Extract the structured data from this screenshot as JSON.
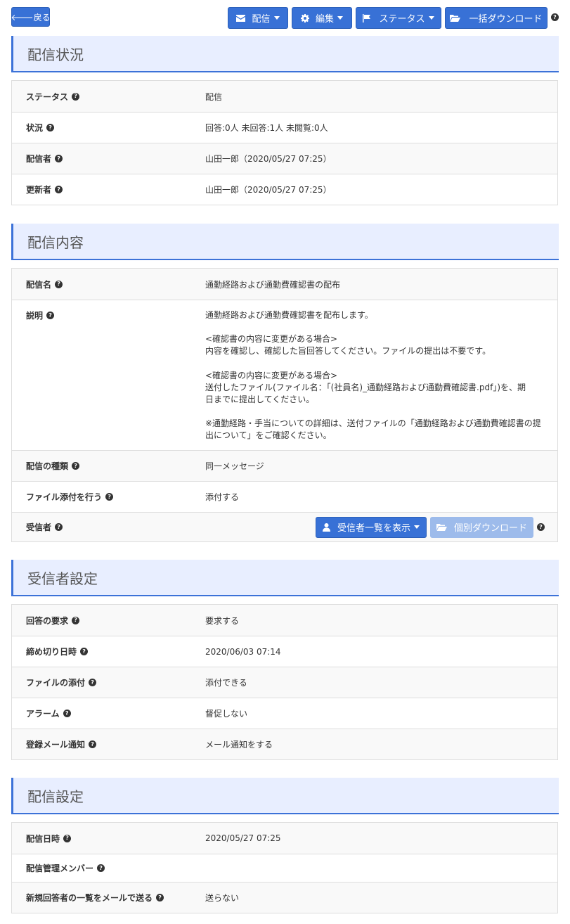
{
  "toolbar": {
    "back_label": "戻る",
    "deliver_label": "配信",
    "edit_label": "編集",
    "status_label": "ステータス",
    "bulk_download_label": "一括ダウンロード"
  },
  "help_glyph": "?",
  "section_status": {
    "title": "配信状況",
    "rows": [
      {
        "label": "ステータス",
        "value": "配信"
      },
      {
        "label": "状況",
        "value": "回答:0人 未回答:1人 未閲覧:0人"
      },
      {
        "label": "配信者",
        "value": "山田一郎（2020/05/27 07:25）"
      },
      {
        "label": "更新者",
        "value": "山田一郎（2020/05/27 07:25）"
      }
    ]
  },
  "section_content": {
    "title": "配信内容",
    "name_label": "配信名",
    "name_value": "通勤経路および通勤費確認書の配布",
    "description_label": "説明",
    "description": [
      "通勤経路および通勤費確認書を配布します。",
      "<確認書の内容に変更がある場合>",
      "内容を確認し、確認した旨回答してください。ファイルの提出は不要です。",
      "<確認書の内容に変更がある場合>",
      "送付したファイル(ファイル名：「(社員名)_通勤経路および通勤費確認書.pdf」)を、期",
      "日までに提出してください。",
      "※通勤経路・手当についての詳細は、送付ファイルの「通勤経路および通勤費確認書の提",
      "出について」をご確認ください。"
    ],
    "type_label": "配信の種類",
    "type_value": "同一メッセージ",
    "attach_label": "ファイル添付を行う",
    "attach_value": "添付する",
    "recipients_label": "受信者",
    "show_recipients_label": "受信者一覧を表示",
    "individual_download_label": "個別ダウンロード"
  },
  "section_recipient": {
    "title": "受信者設定",
    "rows": [
      {
        "label": "回答の要求",
        "value": "要求する"
      },
      {
        "label": "締め切り日時",
        "value": "2020/06/03 07:14"
      },
      {
        "label": "ファイルの添付",
        "value": "添付できる"
      },
      {
        "label": "アラーム",
        "value": "督促しない"
      },
      {
        "label": "登録メール通知",
        "value": "メール通知をする"
      }
    ]
  },
  "section_settings": {
    "title": "配信設定",
    "rows": [
      {
        "label": "配信日時",
        "value": "2020/05/27 07:25"
      },
      {
        "label": "配信管理メンバー",
        "value": ""
      },
      {
        "label": "新規回答者の一覧をメールで送る",
        "value": "送らない"
      }
    ]
  },
  "colors": {
    "primary": "#3871d6",
    "disabled": "#9dbbeb",
    "section_bg": "#e8eeff",
    "accent_border": "#3c72d8"
  }
}
